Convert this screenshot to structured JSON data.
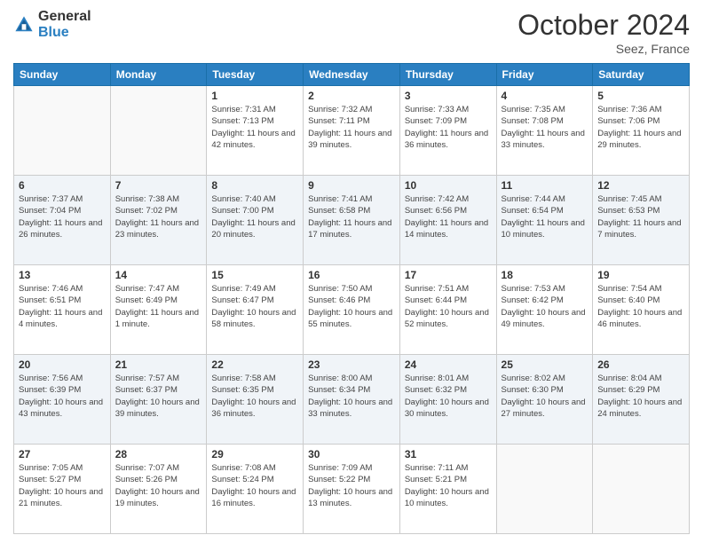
{
  "header": {
    "logo_general": "General",
    "logo_blue": "Blue",
    "month_title": "October 2024",
    "location": "Seez, France"
  },
  "weekdays": [
    "Sunday",
    "Monday",
    "Tuesday",
    "Wednesday",
    "Thursday",
    "Friday",
    "Saturday"
  ],
  "weeks": [
    [
      {
        "day": "",
        "sunrise": "",
        "sunset": "",
        "daylight": ""
      },
      {
        "day": "",
        "sunrise": "",
        "sunset": "",
        "daylight": ""
      },
      {
        "day": "1",
        "sunrise": "Sunrise: 7:31 AM",
        "sunset": "Sunset: 7:13 PM",
        "daylight": "Daylight: 11 hours and 42 minutes."
      },
      {
        "day": "2",
        "sunrise": "Sunrise: 7:32 AM",
        "sunset": "Sunset: 7:11 PM",
        "daylight": "Daylight: 11 hours and 39 minutes."
      },
      {
        "day": "3",
        "sunrise": "Sunrise: 7:33 AM",
        "sunset": "Sunset: 7:09 PM",
        "daylight": "Daylight: 11 hours and 36 minutes."
      },
      {
        "day": "4",
        "sunrise": "Sunrise: 7:35 AM",
        "sunset": "Sunset: 7:08 PM",
        "daylight": "Daylight: 11 hours and 33 minutes."
      },
      {
        "day": "5",
        "sunrise": "Sunrise: 7:36 AM",
        "sunset": "Sunset: 7:06 PM",
        "daylight": "Daylight: 11 hours and 29 minutes."
      }
    ],
    [
      {
        "day": "6",
        "sunrise": "Sunrise: 7:37 AM",
        "sunset": "Sunset: 7:04 PM",
        "daylight": "Daylight: 11 hours and 26 minutes."
      },
      {
        "day": "7",
        "sunrise": "Sunrise: 7:38 AM",
        "sunset": "Sunset: 7:02 PM",
        "daylight": "Daylight: 11 hours and 23 minutes."
      },
      {
        "day": "8",
        "sunrise": "Sunrise: 7:40 AM",
        "sunset": "Sunset: 7:00 PM",
        "daylight": "Daylight: 11 hours and 20 minutes."
      },
      {
        "day": "9",
        "sunrise": "Sunrise: 7:41 AM",
        "sunset": "Sunset: 6:58 PM",
        "daylight": "Daylight: 11 hours and 17 minutes."
      },
      {
        "day": "10",
        "sunrise": "Sunrise: 7:42 AM",
        "sunset": "Sunset: 6:56 PM",
        "daylight": "Daylight: 11 hours and 14 minutes."
      },
      {
        "day": "11",
        "sunrise": "Sunrise: 7:44 AM",
        "sunset": "Sunset: 6:54 PM",
        "daylight": "Daylight: 11 hours and 10 minutes."
      },
      {
        "day": "12",
        "sunrise": "Sunrise: 7:45 AM",
        "sunset": "Sunset: 6:53 PM",
        "daylight": "Daylight: 11 hours and 7 minutes."
      }
    ],
    [
      {
        "day": "13",
        "sunrise": "Sunrise: 7:46 AM",
        "sunset": "Sunset: 6:51 PM",
        "daylight": "Daylight: 11 hours and 4 minutes."
      },
      {
        "day": "14",
        "sunrise": "Sunrise: 7:47 AM",
        "sunset": "Sunset: 6:49 PM",
        "daylight": "Daylight: 11 hours and 1 minute."
      },
      {
        "day": "15",
        "sunrise": "Sunrise: 7:49 AM",
        "sunset": "Sunset: 6:47 PM",
        "daylight": "Daylight: 10 hours and 58 minutes."
      },
      {
        "day": "16",
        "sunrise": "Sunrise: 7:50 AM",
        "sunset": "Sunset: 6:46 PM",
        "daylight": "Daylight: 10 hours and 55 minutes."
      },
      {
        "day": "17",
        "sunrise": "Sunrise: 7:51 AM",
        "sunset": "Sunset: 6:44 PM",
        "daylight": "Daylight: 10 hours and 52 minutes."
      },
      {
        "day": "18",
        "sunrise": "Sunrise: 7:53 AM",
        "sunset": "Sunset: 6:42 PM",
        "daylight": "Daylight: 10 hours and 49 minutes."
      },
      {
        "day": "19",
        "sunrise": "Sunrise: 7:54 AM",
        "sunset": "Sunset: 6:40 PM",
        "daylight": "Daylight: 10 hours and 46 minutes."
      }
    ],
    [
      {
        "day": "20",
        "sunrise": "Sunrise: 7:56 AM",
        "sunset": "Sunset: 6:39 PM",
        "daylight": "Daylight: 10 hours and 43 minutes."
      },
      {
        "day": "21",
        "sunrise": "Sunrise: 7:57 AM",
        "sunset": "Sunset: 6:37 PM",
        "daylight": "Daylight: 10 hours and 39 minutes."
      },
      {
        "day": "22",
        "sunrise": "Sunrise: 7:58 AM",
        "sunset": "Sunset: 6:35 PM",
        "daylight": "Daylight: 10 hours and 36 minutes."
      },
      {
        "day": "23",
        "sunrise": "Sunrise: 8:00 AM",
        "sunset": "Sunset: 6:34 PM",
        "daylight": "Daylight: 10 hours and 33 minutes."
      },
      {
        "day": "24",
        "sunrise": "Sunrise: 8:01 AM",
        "sunset": "Sunset: 6:32 PM",
        "daylight": "Daylight: 10 hours and 30 minutes."
      },
      {
        "day": "25",
        "sunrise": "Sunrise: 8:02 AM",
        "sunset": "Sunset: 6:30 PM",
        "daylight": "Daylight: 10 hours and 27 minutes."
      },
      {
        "day": "26",
        "sunrise": "Sunrise: 8:04 AM",
        "sunset": "Sunset: 6:29 PM",
        "daylight": "Daylight: 10 hours and 24 minutes."
      }
    ],
    [
      {
        "day": "27",
        "sunrise": "Sunrise: 7:05 AM",
        "sunset": "Sunset: 5:27 PM",
        "daylight": "Daylight: 10 hours and 21 minutes."
      },
      {
        "day": "28",
        "sunrise": "Sunrise: 7:07 AM",
        "sunset": "Sunset: 5:26 PM",
        "daylight": "Daylight: 10 hours and 19 minutes."
      },
      {
        "day": "29",
        "sunrise": "Sunrise: 7:08 AM",
        "sunset": "Sunset: 5:24 PM",
        "daylight": "Daylight: 10 hours and 16 minutes."
      },
      {
        "day": "30",
        "sunrise": "Sunrise: 7:09 AM",
        "sunset": "Sunset: 5:22 PM",
        "daylight": "Daylight: 10 hours and 13 minutes."
      },
      {
        "day": "31",
        "sunrise": "Sunrise: 7:11 AM",
        "sunset": "Sunset: 5:21 PM",
        "daylight": "Daylight: 10 hours and 10 minutes."
      },
      {
        "day": "",
        "sunrise": "",
        "sunset": "",
        "daylight": ""
      },
      {
        "day": "",
        "sunrise": "",
        "sunset": "",
        "daylight": ""
      }
    ]
  ]
}
